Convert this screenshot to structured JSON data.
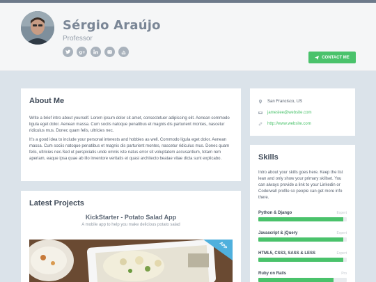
{
  "profile": {
    "name": "Sérgio Araújo",
    "title": "Professor",
    "socials": [
      "twitter-icon",
      "google-plus-icon",
      "linkedin-icon",
      "github-icon",
      "stack-overflow-icon"
    ],
    "contact_label": "CONTACT ME"
  },
  "about": {
    "heading": "About Me",
    "paragraphs": [
      "Write a brief intro about yourself. Lorem ipsum dolor sit amet, consectetuer adipiscing elit. Aenean commodo ligula eget dolor. Aenean massa. Cum sociis natoque penatibus et magnis dis parturient montes, nascetur ridiculus mus. Donec quam felis, ultricies nec.",
      "It's a good idea to include your personal interests and hobbies as well. Commodo ligula eget dolor. Aenean massa. Cum sociis natoque penatibus et magnis dis parturient montes, nascetur ridiculus mus. Donec quam felis, ultricies nec.Sed ut perspiciatis unde omnis iste natus error sit voluptatem accusantium, totam rem aperiam, eaque ipsa quae ab illo inventore veritatis et quasi architecto beatae vitae dicta sunt explicabo."
    ]
  },
  "projects": {
    "heading": "Latest Projects",
    "items": [
      {
        "title": "KickStarter - Potato Salad App",
        "subtitle": "A mobile app to help you make delicious potato salad",
        "ribbon": "APP"
      }
    ]
  },
  "info": {
    "location": "San Francisco, US",
    "email": "jameslee@website.com",
    "website": "http://www.website.com"
  },
  "skills": {
    "heading": "Skills",
    "intro": "Intro about your skills goes here. Keep the list lean and only show your primary skillset. You can always provide a link to your Linkedin or Coderwall profile so people can get more info there.",
    "items": [
      {
        "name": "Python & Django",
        "level": "Expert",
        "progress": 0.96
      },
      {
        "name": "Javascript & jQuery",
        "level": "Expert",
        "progress": 0.96
      },
      {
        "name": "HTML5, CSS3, SASS & LESS",
        "level": "Expert",
        "progress": 0.96
      },
      {
        "name": "Ruby on Rails",
        "level": "Pro",
        "progress": 0.85
      }
    ]
  },
  "colors": {
    "accent": "#4ac26b",
    "header_bg": "#f5f6f7",
    "page_bg": "#dbe3ea"
  }
}
